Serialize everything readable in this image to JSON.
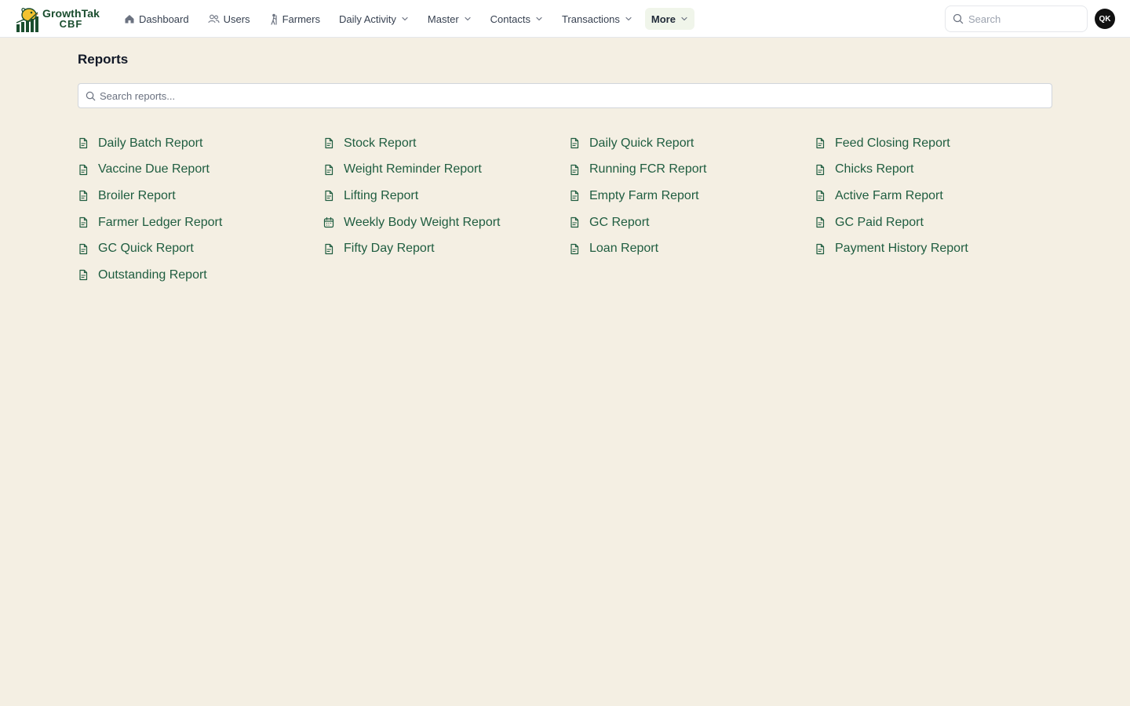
{
  "brand": {
    "line1": "GrowthTak",
    "line2": "CBF"
  },
  "nav": [
    {
      "label": "Dashboard",
      "icon": "home-icon",
      "dropdown": false,
      "active": false
    },
    {
      "label": "Users",
      "icon": "users-icon",
      "dropdown": false,
      "active": false
    },
    {
      "label": "Farmers",
      "icon": "farmer-icon",
      "dropdown": false,
      "active": false
    },
    {
      "label": "Daily Activity",
      "icon": "",
      "dropdown": true,
      "active": false
    },
    {
      "label": "Master",
      "icon": "",
      "dropdown": true,
      "active": false
    },
    {
      "label": "Contacts",
      "icon": "",
      "dropdown": true,
      "active": false
    },
    {
      "label": "Transactions",
      "icon": "",
      "dropdown": true,
      "active": false
    },
    {
      "label": "More",
      "icon": "",
      "dropdown": true,
      "active": true
    }
  ],
  "search": {
    "placeholder": "Search"
  },
  "user": {
    "initials": "QK"
  },
  "page": {
    "title": "Reports",
    "search_placeholder": "Search reports..."
  },
  "reports": [
    {
      "label": "Daily Batch Report",
      "icon": "document-icon"
    },
    {
      "label": "Stock Report",
      "icon": "document-icon"
    },
    {
      "label": "Daily Quick Report",
      "icon": "document-icon"
    },
    {
      "label": "Feed Closing Report",
      "icon": "document-icon"
    },
    {
      "label": "Vaccine Due Report",
      "icon": "document-icon"
    },
    {
      "label": "Weight Reminder Report",
      "icon": "document-icon"
    },
    {
      "label": "Running FCR Report",
      "icon": "document-icon"
    },
    {
      "label": "Chicks Report",
      "icon": "document-icon"
    },
    {
      "label": "Broiler Report",
      "icon": "document-icon"
    },
    {
      "label": "Lifting Report",
      "icon": "document-icon"
    },
    {
      "label": "Empty Farm Report",
      "icon": "document-icon"
    },
    {
      "label": "Active Farm Report",
      "icon": "document-icon"
    },
    {
      "label": "Farmer Ledger Report",
      "icon": "document-icon"
    },
    {
      "label": "Weekly Body Weight Report",
      "icon": "calendar-icon"
    },
    {
      "label": "GC Report",
      "icon": "document-icon"
    },
    {
      "label": "GC Paid Report",
      "icon": "document-icon"
    },
    {
      "label": "GC Quick Report",
      "icon": "document-icon"
    },
    {
      "label": "Fifty Day Report",
      "icon": "document-icon"
    },
    {
      "label": "Loan Report",
      "icon": "document-icon"
    },
    {
      "label": "Payment History Report",
      "icon": "document-icon"
    },
    {
      "label": "Outstanding Report",
      "icon": "document-icon"
    }
  ],
  "colors": {
    "background": "#f4efe3",
    "link": "#1f5d40",
    "brand": "#1a4d2e",
    "avatar": "#111111"
  }
}
